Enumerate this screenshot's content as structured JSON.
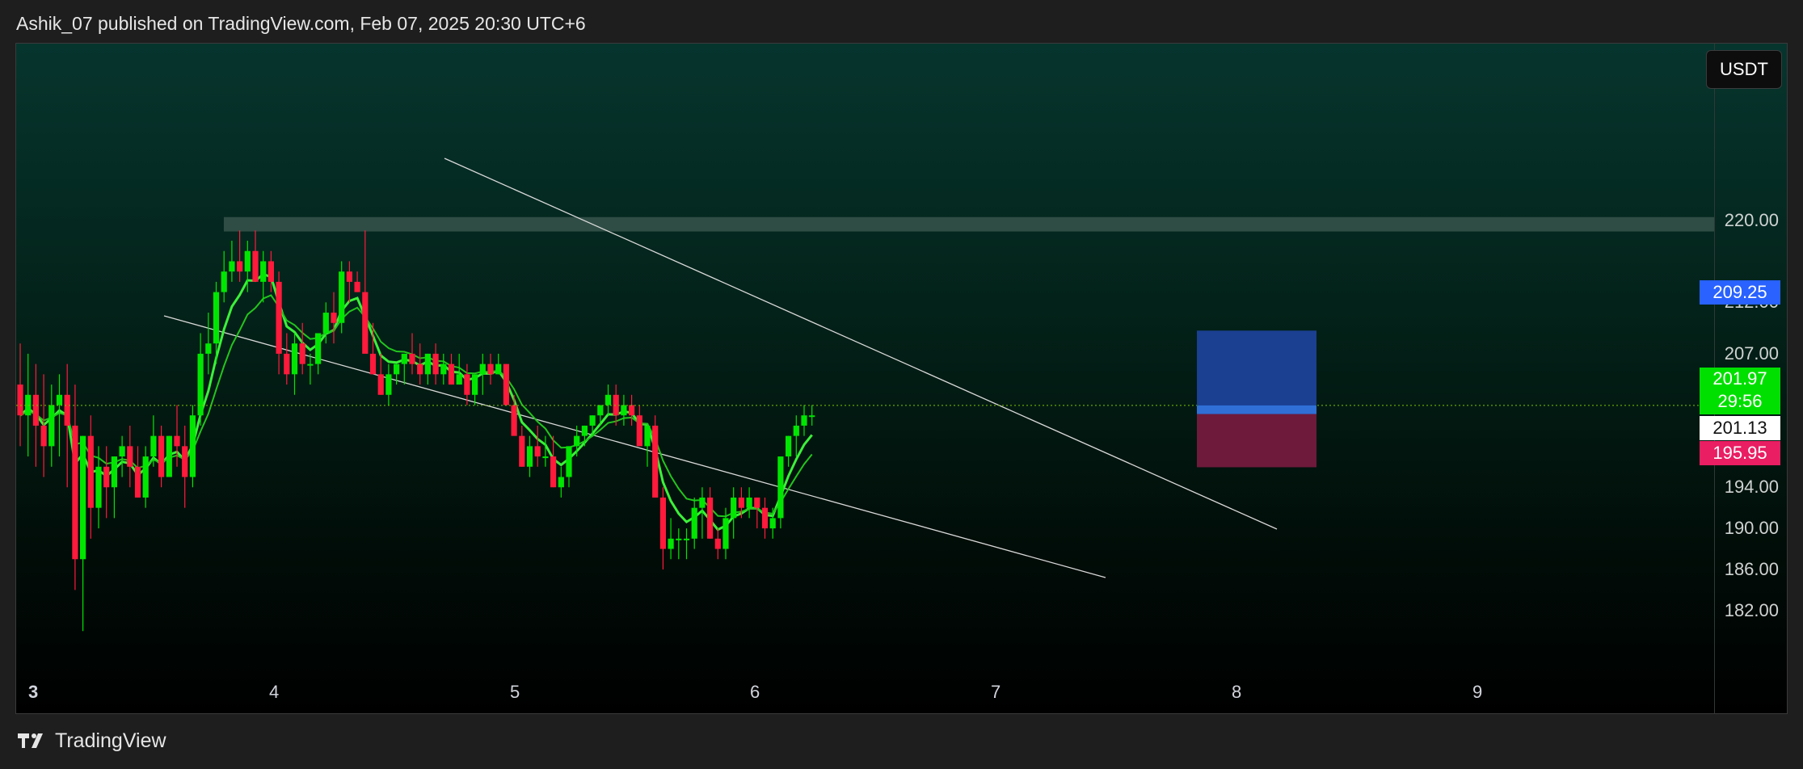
{
  "header": {
    "attribution": "Ashik_07 published on TradingView.com, Feb 07, 2025 20:30 UTC+6"
  },
  "footer": {
    "brand": "TradingView",
    "logo_icon": "tradingview-logo-icon"
  },
  "currency": "USDT",
  "price_tags": {
    "target": "209.25",
    "last": "201.97",
    "countdown": "29:56",
    "entry": "201.13",
    "stop": "195.95"
  },
  "colors": {
    "up": "#00e600",
    "down": "#ff1a3c",
    "ema_fast": "#23c41e",
    "ema_slow": "#3cf03a",
    "target_zone": "#1b3f91",
    "stop_zone": "#6e1a3b",
    "resistance_zone": "#3d5a52"
  },
  "chart_data": {
    "type": "candlestick",
    "y_ticks": [
      "220.00",
      "212.00",
      "207.00",
      "194.00",
      "190.00",
      "186.00",
      "182.00"
    ],
    "x_ticks": [
      "3",
      "4",
      "5",
      "6",
      "7",
      "8",
      "9"
    ],
    "ylim": [
      179,
      225
    ],
    "resistance_zone": [
      218.9,
      220.3
    ],
    "position": {
      "target": 209.25,
      "entry": 201.13,
      "stop": 195.95,
      "last": 201.97
    },
    "candles": [
      [
        204,
        208,
        198,
        201
      ],
      [
        201,
        207,
        197,
        203
      ],
      [
        203,
        206,
        196,
        200
      ],
      [
        200,
        205,
        195,
        198
      ],
      [
        198,
        204,
        196,
        202
      ],
      [
        202,
        205,
        197,
        203
      ],
      [
        203,
        206,
        194,
        200
      ],
      [
        200,
        204,
        184,
        187
      ],
      [
        187,
        199,
        180,
        199
      ],
      [
        199,
        201,
        189,
        192
      ],
      [
        192,
        198,
        190,
        196
      ],
      [
        196,
        198,
        191,
        194
      ],
      [
        194,
        197,
        191,
        197
      ],
      [
        197,
        199,
        195,
        198
      ],
      [
        198,
        200,
        194,
        196
      ],
      [
        196,
        198,
        193,
        193
      ],
      [
        193,
        198,
        192,
        197
      ],
      [
        197,
        201,
        196,
        199
      ],
      [
        199,
        200,
        194,
        195
      ],
      [
        195,
        199,
        195,
        199
      ],
      [
        199,
        202,
        196,
        198
      ],
      [
        198,
        200,
        192,
        195
      ],
      [
        195,
        202,
        194,
        201
      ],
      [
        201,
        209,
        200,
        207
      ],
      [
        207,
        211,
        205,
        208
      ],
      [
        208,
        214,
        206,
        213
      ],
      [
        213,
        217,
        212,
        215
      ],
      [
        215,
        218,
        214,
        216
      ],
      [
        216,
        219,
        214,
        215
      ],
      [
        215,
        218,
        213,
        217
      ],
      [
        217,
        219,
        215,
        214
      ],
      [
        214,
        217,
        212,
        216
      ],
      [
        216,
        217,
        213,
        214
      ],
      [
        214,
        215,
        205,
        207
      ],
      [
        207,
        209,
        204,
        205
      ],
      [
        205,
        209,
        203,
        208
      ],
      [
        208,
        210,
        205,
        206
      ],
      [
        206,
        207,
        204,
        206
      ],
      [
        206,
        209,
        205,
        209
      ],
      [
        209,
        212,
        208,
        211
      ],
      [
        211,
        213,
        208,
        210
      ],
      [
        210,
        216,
        209,
        215
      ],
      [
        215,
        216,
        212,
        214
      ],
      [
        214,
        215,
        213,
        213
      ],
      [
        213,
        219,
        210,
        207
      ],
      [
        207,
        210,
        205,
        205
      ],
      [
        205,
        207,
        203,
        203
      ],
      [
        203,
        206,
        202,
        205
      ],
      [
        205,
        206,
        204,
        206
      ],
      [
        206,
        207,
        204,
        207
      ],
      [
        207,
        209,
        205,
        206
      ],
      [
        206,
        208,
        204,
        205
      ],
      [
        205,
        207,
        204,
        207
      ],
      [
        207,
        208,
        204,
        205
      ],
      [
        205,
        207,
        204,
        206
      ],
      [
        206,
        207,
        204,
        204
      ],
      [
        204,
        207,
        204,
        205
      ],
      [
        205,
        206,
        202,
        203
      ],
      [
        203,
        205,
        202,
        205
      ],
      [
        205,
        207,
        203,
        206
      ],
      [
        206,
        207,
        204,
        205
      ],
      [
        205,
        207,
        205,
        206
      ],
      [
        206,
        206,
        202,
        202
      ],
      [
        202,
        203,
        200,
        199
      ],
      [
        199,
        200,
        196,
        196
      ],
      [
        196,
        199,
        195,
        198
      ],
      [
        198,
        200,
        196,
        197
      ],
      [
        197,
        199,
        196,
        197
      ],
      [
        197,
        199,
        194,
        194
      ],
      [
        194,
        196,
        193,
        195
      ],
      [
        195,
        198,
        194,
        198
      ],
      [
        198,
        200,
        197,
        199
      ],
      [
        199,
        200,
        198,
        200
      ],
      [
        200,
        201,
        199,
        201
      ],
      [
        201,
        202,
        200,
        202
      ],
      [
        202,
        204,
        201,
        203
      ],
      [
        203,
        204,
        200,
        201
      ],
      [
        201,
        203,
        200,
        202
      ],
      [
        202,
        203,
        200,
        201
      ],
      [
        201,
        202,
        198,
        198
      ],
      [
        198,
        200,
        196,
        200
      ],
      [
        200,
        201,
        193,
        193
      ],
      [
        193,
        194,
        186,
        188
      ],
      [
        188,
        191,
        187,
        189
      ],
      [
        189,
        190,
        187,
        189
      ],
      [
        189,
        190,
        187,
        189
      ],
      [
        189,
        193,
        188,
        192
      ],
      [
        192,
        194,
        189,
        193
      ],
      [
        193,
        194,
        189,
        189
      ],
      [
        189,
        190,
        187,
        188
      ],
      [
        188,
        192,
        187,
        191
      ],
      [
        191,
        194,
        189,
        193
      ],
      [
        193,
        194,
        191,
        192
      ],
      [
        192,
        194,
        191,
        193
      ],
      [
        193,
        193,
        190,
        192
      ],
      [
        192,
        193,
        189,
        190
      ],
      [
        190,
        192,
        189,
        191
      ],
      [
        191,
        196,
        190,
        197
      ],
      [
        197,
        199,
        196,
        199
      ],
      [
        199,
        201,
        197,
        200
      ],
      [
        200,
        202,
        199,
        201
      ],
      [
        201,
        202,
        200,
        201
      ]
    ]
  }
}
